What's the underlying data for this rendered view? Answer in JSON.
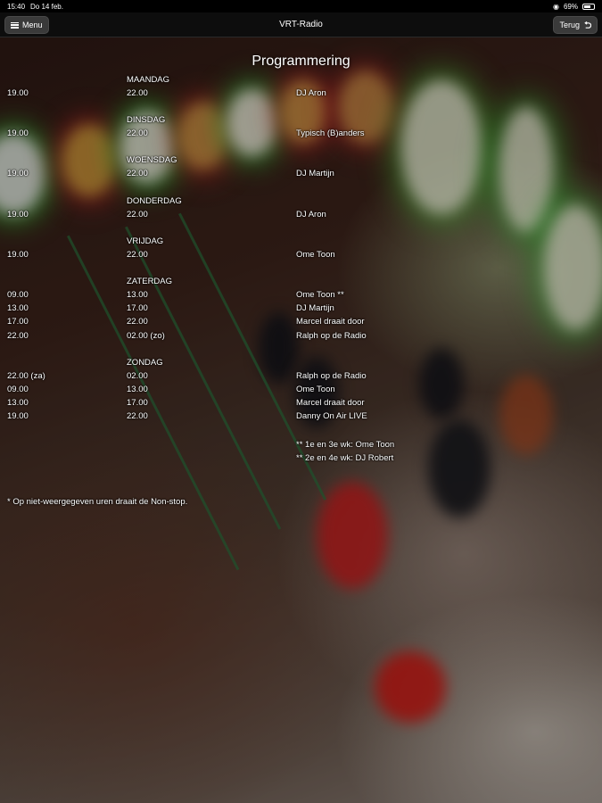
{
  "status_bar": {
    "time": "15:40",
    "date": "Do 14 feb.",
    "battery_text": "69%",
    "battery_level": 0.69
  },
  "nav": {
    "title": "VRT-Radio",
    "menu_label": "Menu",
    "back_label": "Terug"
  },
  "page": {
    "heading": "Programmering",
    "days": [
      {
        "name": "MAANDAG",
        "slots": [
          {
            "start": "19.00",
            "end": "22.00",
            "show": "DJ Aron"
          }
        ]
      },
      {
        "name": "DINSDAG",
        "slots": [
          {
            "start": "19.00",
            "end": "22.00",
            "show": "Typisch (B)anders"
          }
        ]
      },
      {
        "name": "WOENSDAG",
        "slots": [
          {
            "start": "19.00",
            "end": "22.00",
            "show": "DJ Martijn"
          }
        ]
      },
      {
        "name": "DONDERDAG",
        "slots": [
          {
            "start": "19.00",
            "end": "22.00",
            "show": "DJ Aron"
          }
        ]
      },
      {
        "name": "VRIJDAG",
        "slots": [
          {
            "start": "19.00",
            "end": "22.00",
            "show": "Ome Toon"
          }
        ]
      },
      {
        "name": "ZATERDAG",
        "slots": [
          {
            "start": "09.00",
            "end": "13.00",
            "show": "Ome Toon **"
          },
          {
            "start": "13.00",
            "end": "17.00",
            "show": "DJ Martijn"
          },
          {
            "start": "17.00",
            "end": "22.00",
            "show": "Marcel draait door"
          },
          {
            "start": "22.00",
            "end": "02.00 (zo)",
            "show": "Ralph op de Radio"
          }
        ]
      },
      {
        "name": "ZONDAG",
        "slots": [
          {
            "start": "22.00 (za)",
            "end": "02.00",
            "show": "Ralph op de Radio"
          },
          {
            "start": "09.00",
            "end": "13.00",
            "show": "Ome Toon"
          },
          {
            "start": "13.00",
            "end": "17.00",
            "show": "Marcel draait door"
          },
          {
            "start": "19.00",
            "end": "22.00",
            "show": "Danny On Air LIVE"
          }
        ]
      }
    ],
    "notes": [
      "** 1e en 3e wk: Ome Toon",
      "** 2e en 4e wk: DJ Robert"
    ],
    "footnote": "* Op niet-weergegeven uren draait de Non-stop."
  }
}
